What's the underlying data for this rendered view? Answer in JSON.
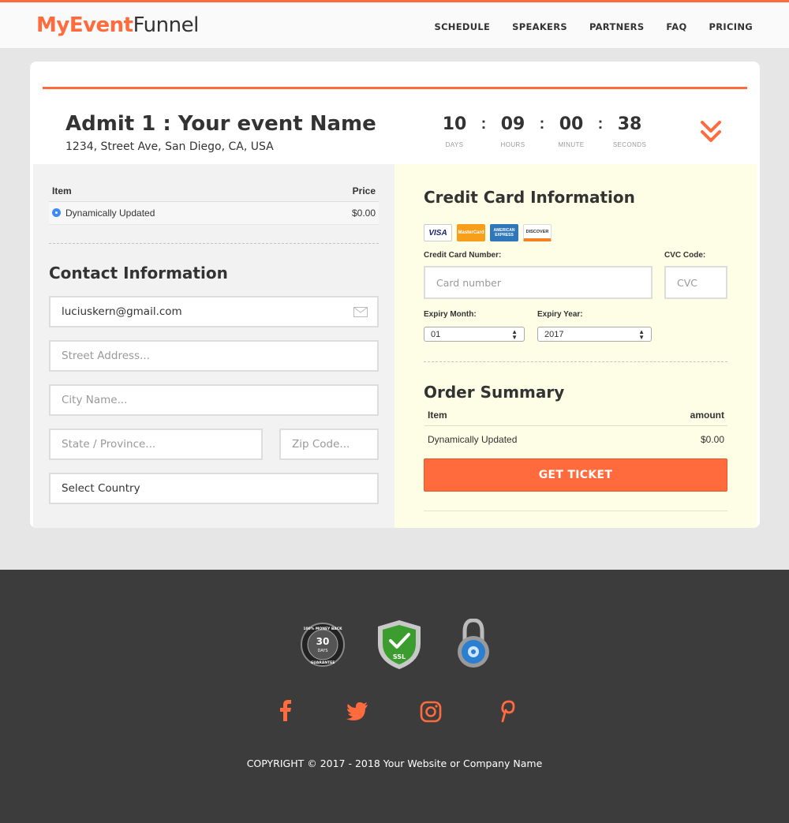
{
  "header": {
    "logo_part1": "MyEvent",
    "logo_part2": "Funnel",
    "nav": [
      "SCHEDULE",
      "SPEAKERS",
      "PARTNERS",
      "FAQ",
      "PRICING"
    ],
    "accent_color": "#ff6b3d"
  },
  "event": {
    "title": "Admit 1 : Your event Name",
    "address": "1234, Street Ave, San Diego, CA, USA"
  },
  "countdown": {
    "days": "10",
    "hours": "09",
    "minutes": "00",
    "seconds": "38",
    "days_label": "DAYS",
    "hours_label": "HOURS",
    "minutes_label": "MINUTE",
    "seconds_label": "SECONDS",
    "expand_icon": "double-chevron-down-icon"
  },
  "items": {
    "col_item": "Item",
    "col_price": "Price",
    "rows": [
      {
        "name": "Dynamically Updated",
        "price": "$0.00",
        "selected": true
      }
    ]
  },
  "contact": {
    "title": "Contact Information",
    "email_value": "luciuskern@gmail.com",
    "street_placeholder": "Street Address...",
    "city_placeholder": "City Name...",
    "state_placeholder": "State / Province...",
    "zip_placeholder": "Zip Code...",
    "country_value": "Select Country"
  },
  "payment": {
    "title": "Credit Card Information",
    "card_brands": [
      "VISA",
      "MasterCard",
      "AMERICAN EXPRESS",
      "DISCOVER"
    ],
    "card_number_label": "Credit Card Number:",
    "card_number_placeholder": "Card number",
    "cvc_label": "CVC Code:",
    "cvc_placeholder": "CVC",
    "expiry_month_label": "Expiry Month:",
    "expiry_month_value": "01",
    "expiry_year_label": "Expiry Year:",
    "expiry_year_value": "2017"
  },
  "order": {
    "title": "Order Summary",
    "col_item": "Item",
    "col_amount": "amount",
    "rows": [
      {
        "name": "Dynamically Updated",
        "amount": "$0.00"
      }
    ],
    "button_label": "GET TICKET"
  },
  "footer": {
    "badges": [
      "money-back-guarantee-badge",
      "ssl-shield-badge",
      "padlock-badge"
    ],
    "money_back_text": {
      "days": "30",
      "days_word": "DAYS",
      "top": "100% MONEY BACK",
      "bottom": "GUARANTEE"
    },
    "ssl_text": "SSL",
    "social": [
      "facebook-icon",
      "twitter-icon",
      "instagram-icon",
      "pinterest-icon"
    ],
    "copyright": "COPYRIGHT © 2017 - 2018 Your Website or Company Name"
  }
}
